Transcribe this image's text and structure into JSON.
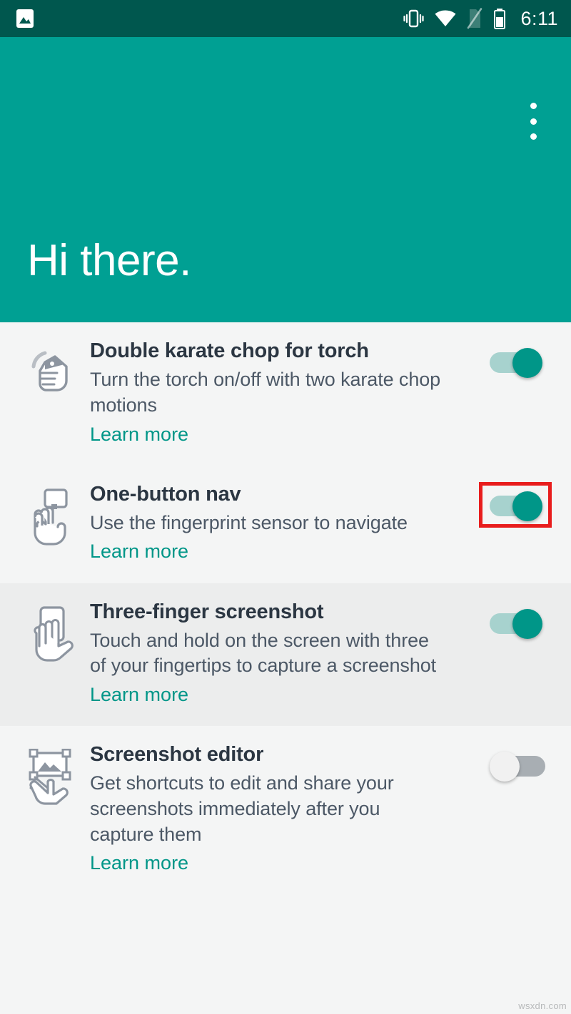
{
  "statusbar": {
    "time": "6:11",
    "icons": [
      {
        "name": "image-icon"
      },
      {
        "name": "vibrate-icon"
      },
      {
        "name": "wifi-icon"
      },
      {
        "name": "signal-off-icon"
      },
      {
        "name": "battery-icon"
      }
    ]
  },
  "header": {
    "greeting": "Hi there.",
    "overflow_label": "More options",
    "bg_color": "#00a093",
    "statusbar_color": "#00574e"
  },
  "accent_color": "#009688",
  "highlight_color": "#e81d1d",
  "items": [
    {
      "icon": "karate-chop-hand-icon",
      "title": "Double karate chop for torch",
      "description": "Turn the torch on/off with two karate chop motions",
      "link": "Learn more",
      "toggle_state": "on",
      "highlighted": false,
      "shaded": false
    },
    {
      "icon": "one-button-nav-hand-icon",
      "title": "One-button nav",
      "description": "Use the fingerprint sensor to navigate",
      "link": "Learn more",
      "toggle_state": "on",
      "highlighted": true,
      "shaded": false
    },
    {
      "icon": "three-finger-hand-icon",
      "title": "Three-finger screenshot",
      "description": "Touch and hold on the screen with three of your fingertips to capture a screenshot",
      "link": "Learn more",
      "toggle_state": "on",
      "highlighted": false,
      "shaded": true
    },
    {
      "icon": "screenshot-editor-icon",
      "title": "Screenshot editor",
      "description": "Get shortcuts to edit and share your screenshots immediately after you capture them",
      "link": "Learn more",
      "toggle_state": "off",
      "highlighted": false,
      "shaded": false
    }
  ],
  "watermark": "wsxdn.com"
}
